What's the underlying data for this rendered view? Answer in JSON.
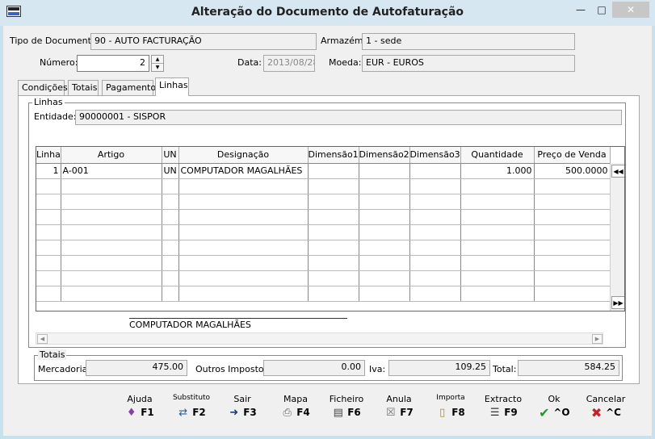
{
  "window": {
    "title": "Alteração do Documento de Autofaturação"
  },
  "header": {
    "tipo_label": "Tipo de Documento:",
    "tipo_value": "90 - AUTO FACTURAÇÃO",
    "armazem_label": "Armazém:",
    "armazem_value": "1 - sede",
    "numero_label": "Número:",
    "numero_value": "2",
    "data_label": "Data:",
    "data_value": "2013/08/28",
    "moeda_label": "Moeda:",
    "moeda_value": "EUR - EUROS"
  },
  "tabs": [
    {
      "label": "Condições"
    },
    {
      "label": "Totais"
    },
    {
      "label": "Pagamento"
    },
    {
      "label": "Linhas"
    }
  ],
  "linhas": {
    "group_title": "Linhas",
    "entidade_label": "Entidade:",
    "entidade_value": "90000001 - SISPOR",
    "columns": [
      "Linha",
      "Artigo",
      "UN",
      "Designação",
      "Dimensão1",
      "Dimensão2",
      "Dimensão3",
      "Quantidade",
      "Preço de Venda"
    ],
    "rows": [
      {
        "linha": "1",
        "artigo": "A-001",
        "un": "UN",
        "designacao": "COMPUTADOR MAGALHÃES",
        "dim1": "",
        "dim2": "",
        "dim3": "",
        "quantidade": "1.000",
        "preco": "500.0000"
      }
    ],
    "description": "COMPUTADOR MAGALHÃES"
  },
  "totais": {
    "group_title": "Totais",
    "mercadoria_label": "Mercadoria:",
    "mercadoria_value": "475.00",
    "outros_label": "Outros Impostos:",
    "outros_value": "0.00",
    "iva_label": "Iva:",
    "iva_value": "109.25",
    "total_label": "Total:",
    "total_value": "584.25"
  },
  "toolbar": [
    {
      "top": "Ajuda",
      "key": "F1",
      "icon": "book-icon"
    },
    {
      "top": "Substituto",
      "key": "F2",
      "icon": "substitute-icon"
    },
    {
      "top": "Sair",
      "key": "F3",
      "icon": "exit-icon"
    },
    {
      "top": "Mapa",
      "key": "F4",
      "icon": "printer-icon"
    },
    {
      "top": "Ficheiro",
      "key": "F6",
      "icon": "file-icon"
    },
    {
      "top": "Anula",
      "key": "F7",
      "icon": "cancel-doc-icon"
    },
    {
      "top": "Importa",
      "key": "F8",
      "icon": "import-icon"
    },
    {
      "top": "Extracto",
      "key": "F9",
      "icon": "statement-icon"
    },
    {
      "top": "Ok",
      "key": "^O",
      "icon": "checkmark-icon"
    },
    {
      "top": "Cancelar",
      "key": "^C",
      "icon": "x-icon"
    }
  ],
  "colors": {
    "ok_green": "#1e9a2c",
    "cancel_red": "#c8202a",
    "titlebar": "#d7e7f2"
  }
}
